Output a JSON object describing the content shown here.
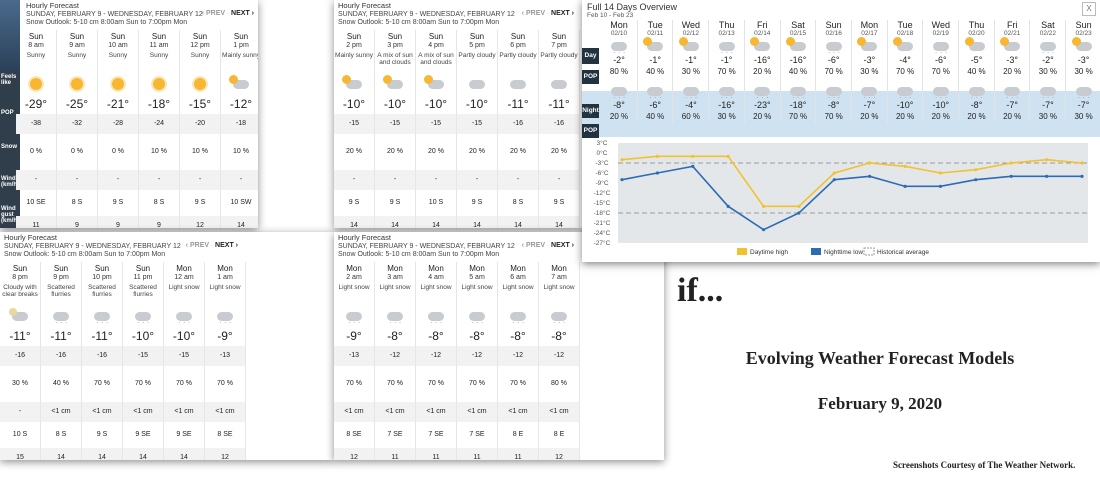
{
  "panel_common": {
    "title": "Hourly Forecast",
    "range": "SUNDAY, FEBRUARY 9 - WEDNESDAY, FEBRUARY 12",
    "outlook": "Snow Outlook: 5-10 cm 8:00am Sun to 7:00pm Mon",
    "prev": "‹ PREV",
    "next": "NEXT ›"
  },
  "row_labels": {
    "feels": "Feels like",
    "pop": "POP",
    "snow": "Snow",
    "wind": "Wind (km/h)",
    "gust": "Wind gust (km/h)"
  },
  "panel1": [
    {
      "day": "Sun",
      "time": "8 am",
      "cond": "Sunny",
      "icon": "sun-icon",
      "temp": "-29°",
      "feels": "-38",
      "pop": "0 %",
      "snow": "-",
      "wind": "10 SE",
      "gust": "11"
    },
    {
      "day": "Sun",
      "time": "9 am",
      "cond": "Sunny",
      "icon": "sun-icon",
      "temp": "-25°",
      "feels": "-32",
      "pop": "0 %",
      "snow": "-",
      "wind": "8 S",
      "gust": "9"
    },
    {
      "day": "Sun",
      "time": "10 am",
      "cond": "Sunny",
      "icon": "sun-icon",
      "temp": "-21°",
      "feels": "-28",
      "pop": "0 %",
      "snow": "-",
      "wind": "9 S",
      "gust": "9"
    },
    {
      "day": "Sun",
      "time": "11 am",
      "cond": "Sunny",
      "icon": "sun-icon",
      "temp": "-18°",
      "feels": "-24",
      "pop": "10 %",
      "snow": "-",
      "wind": "8 S",
      "gust": "9"
    },
    {
      "day": "Sun",
      "time": "12 pm",
      "cond": "Sunny",
      "icon": "sun-icon",
      "temp": "-15°",
      "feels": "-20",
      "pop": "10 %",
      "snow": "-",
      "wind": "9 S",
      "gust": "12"
    },
    {
      "day": "Sun",
      "time": "1 pm",
      "cond": "Mainly sunny",
      "icon": "sun-cloud-icon",
      "temp": "-12°",
      "feels": "-18",
      "pop": "10 %",
      "snow": "-",
      "wind": "10 SW",
      "gust": "14"
    }
  ],
  "panel2": [
    {
      "day": "Sun",
      "time": "2 pm",
      "cond": "Mainly sunny",
      "icon": "sun-cloud-icon",
      "temp": "-10°",
      "feels": "-15",
      "pop": "20 %",
      "snow": "-",
      "wind": "9 S",
      "gust": "14"
    },
    {
      "day": "Sun",
      "time": "3 pm",
      "cond": "A mix of sun and clouds",
      "icon": "sun-cloud-icon",
      "temp": "-10°",
      "feels": "-15",
      "pop": "20 %",
      "snow": "-",
      "wind": "9 S",
      "gust": "14"
    },
    {
      "day": "Sun",
      "time": "4 pm",
      "cond": "A mix of sun and clouds",
      "icon": "sun-cloud-icon",
      "temp": "-10°",
      "feels": "-15",
      "pop": "20 %",
      "snow": "-",
      "wind": "10 S",
      "gust": "14"
    },
    {
      "day": "Sun",
      "time": "5 pm",
      "cond": "Partly cloudy",
      "icon": "cloud-icon",
      "temp": "-10°",
      "feels": "-15",
      "pop": "20 %",
      "snow": "-",
      "wind": "9 S",
      "gust": "14"
    },
    {
      "day": "Sun",
      "time": "6 pm",
      "cond": "Partly cloudy",
      "icon": "cloud-icon",
      "temp": "-11°",
      "feels": "-16",
      "pop": "20 %",
      "snow": "-",
      "wind": "8 S",
      "gust": "14"
    },
    {
      "day": "Sun",
      "time": "7 pm",
      "cond": "Partly cloudy",
      "icon": "cloud-icon",
      "temp": "-11°",
      "feels": "-16",
      "pop": "20 %",
      "snow": "-",
      "wind": "9 S",
      "gust": "14"
    }
  ],
  "panel3": [
    {
      "day": "Sun",
      "time": "8 pm",
      "cond": "Cloudy with clear breaks",
      "icon": "cloud-moon-icon",
      "temp": "-11°",
      "feels": "-16",
      "pop": "30 %",
      "snow": "-",
      "wind": "10 S",
      "gust": "15"
    },
    {
      "day": "Sun",
      "time": "9 pm",
      "cond": "Scattered flurries",
      "icon": "snow-cloud-icon",
      "temp": "-11°",
      "feels": "-16",
      "pop": "40 %",
      "snow": "<1 cm",
      "wind": "8 S",
      "gust": "14"
    },
    {
      "day": "Sun",
      "time": "10 pm",
      "cond": "Scattered flurries",
      "icon": "snow-cloud-icon",
      "temp": "-11°",
      "feels": "-16",
      "pop": "70 %",
      "snow": "<1 cm",
      "wind": "9 S",
      "gust": "14"
    },
    {
      "day": "Sun",
      "time": "11 pm",
      "cond": "Scattered flurries",
      "icon": "snow-cloud-icon",
      "temp": "-10°",
      "feels": "-15",
      "pop": "70 %",
      "snow": "<1 cm",
      "wind": "9 SE",
      "gust": "14"
    },
    {
      "day": "Mon",
      "time": "12 am",
      "cond": "Light snow",
      "icon": "snow-cloud-icon",
      "temp": "-10°",
      "feels": "-15",
      "pop": "70 %",
      "snow": "<1 cm",
      "wind": "9 SE",
      "gust": "14"
    },
    {
      "day": "Mon",
      "time": "1 am",
      "cond": "Light snow",
      "icon": "snow-cloud-icon",
      "temp": "-9°",
      "feels": "-13",
      "pop": "70 %",
      "snow": "<1 cm",
      "wind": "8 SE",
      "gust": "12"
    }
  ],
  "panel4": [
    {
      "day": "Mon",
      "time": "2 am",
      "cond": "Light snow",
      "icon": "snow-cloud-icon",
      "temp": "-9°",
      "feels": "-13",
      "pop": "70 %",
      "snow": "<1 cm",
      "wind": "8 SE",
      "gust": "12"
    },
    {
      "day": "Mon",
      "time": "3 am",
      "cond": "Light snow",
      "icon": "snow-cloud-icon",
      "temp": "-8°",
      "feels": "-12",
      "pop": "70 %",
      "snow": "<1 cm",
      "wind": "7 SE",
      "gust": "11"
    },
    {
      "day": "Mon",
      "time": "4 am",
      "cond": "Light snow",
      "icon": "snow-cloud-icon",
      "temp": "-8°",
      "feels": "-12",
      "pop": "70 %",
      "snow": "<1 cm",
      "wind": "7 SE",
      "gust": "11"
    },
    {
      "day": "Mon",
      "time": "5 am",
      "cond": "Light snow",
      "icon": "snow-cloud-icon",
      "temp": "-8°",
      "feels": "-12",
      "pop": "70 %",
      "snow": "<1 cm",
      "wind": "7 SE",
      "gust": "11"
    },
    {
      "day": "Mon",
      "time": "6 am",
      "cond": "Light snow",
      "icon": "snow-cloud-icon",
      "temp": "-8°",
      "feels": "-12",
      "pop": "70 %",
      "snow": "<1 cm",
      "wind": "8 E",
      "gust": "11"
    },
    {
      "day": "Mon",
      "time": "7 am",
      "cond": "Light snow",
      "icon": "snow-cloud-icon",
      "temp": "-8°",
      "feels": "-12",
      "pop": "80 %",
      "snow": "<1 cm",
      "wind": "8 E",
      "gust": "12"
    }
  ],
  "overview": {
    "title": "Full 14 Days Overview",
    "subtitle": "Feb 10 - Feb 23",
    "close": "X",
    "day_label": "Day",
    "pop_label": "POP",
    "night_label": "Night",
    "days": [
      {
        "name": "Mon",
        "date": "02/10",
        "high": "-2°",
        "dpop": "80 %",
        "low": "-8°",
        "npop": "20 %"
      },
      {
        "name": "Tue",
        "date": "02/11",
        "high": "-1°",
        "dpop": "40 %",
        "low": "-6°",
        "npop": "40 %"
      },
      {
        "name": "Wed",
        "date": "02/12",
        "high": "-1°",
        "dpop": "30 %",
        "low": "-4°",
        "npop": "60 %"
      },
      {
        "name": "Thu",
        "date": "02/13",
        "high": "-1°",
        "dpop": "70 %",
        "low": "-16°",
        "npop": "30 %"
      },
      {
        "name": "Fri",
        "date": "02/14",
        "high": "-16°",
        "dpop": "20 %",
        "low": "-23°",
        "npop": "20 %"
      },
      {
        "name": "Sat",
        "date": "02/15",
        "high": "-16°",
        "dpop": "40 %",
        "low": "-18°",
        "npop": "70 %"
      },
      {
        "name": "Sun",
        "date": "02/16",
        "high": "-6°",
        "dpop": "70 %",
        "low": "-8°",
        "npop": "70 %"
      },
      {
        "name": "Mon",
        "date": "02/17",
        "high": "-3°",
        "dpop": "30 %",
        "low": "-7°",
        "npop": "20 %"
      },
      {
        "name": "Tue",
        "date": "02/18",
        "high": "-4°",
        "dpop": "70 %",
        "low": "-10°",
        "npop": "20 %"
      },
      {
        "name": "Wed",
        "date": "02/19",
        "high": "-6°",
        "dpop": "70 %",
        "low": "-10°",
        "npop": "20 %"
      },
      {
        "name": "Thu",
        "date": "02/20",
        "high": "-5°",
        "dpop": "40 %",
        "low": "-8°",
        "npop": "20 %"
      },
      {
        "name": "Fri",
        "date": "02/21",
        "high": "-3°",
        "dpop": "20 %",
        "low": "-7°",
        "npop": "20 %"
      },
      {
        "name": "Sat",
        "date": "02/22",
        "high": "-2°",
        "dpop": "30 %",
        "low": "-7°",
        "npop": "30 %"
      },
      {
        "name": "Sun",
        "date": "02/23",
        "high": "-3°",
        "dpop": "30 %",
        "low": "-7°",
        "npop": "30 %"
      }
    ]
  },
  "chart_data": {
    "type": "line",
    "x": [
      "02/10",
      "02/11",
      "02/12",
      "02/13",
      "02/14",
      "02/15",
      "02/16",
      "02/17",
      "02/18",
      "02/19",
      "02/20",
      "02/21",
      "02/22",
      "02/23"
    ],
    "series": [
      {
        "name": "Daytime high",
        "color": "#f2c12e",
        "values": [
          -2,
          -1,
          -1,
          -1,
          -16,
          -16,
          -6,
          -3,
          -4,
          -6,
          -5,
          -3,
          -2,
          -3
        ]
      },
      {
        "name": "Nighttime low",
        "color": "#2d6bb5",
        "values": [
          -8,
          -6,
          -4,
          -16,
          -23,
          -18,
          -8,
          -7,
          -10,
          -10,
          -8,
          -7,
          -7,
          -7
        ]
      },
      {
        "name": "Historical average",
        "color": "#999999",
        "values": [
          -3,
          -3,
          -3,
          -3,
          -3,
          -3,
          -3,
          -3,
          -3,
          -3,
          -3,
          -3,
          -3,
          -3
        ]
      },
      {
        "name": "Historical average low",
        "color": "#999999",
        "values": [
          -18,
          -18,
          -18,
          -18,
          -18,
          -18,
          -18,
          -18,
          -18,
          -18,
          -18,
          -18,
          -18,
          -18
        ]
      }
    ],
    "yticks": [
      "3°C",
      "0°C",
      "-3°C",
      "-6°C",
      "-9°C",
      "-12°C",
      "-15°C",
      "-18°C",
      "-21°C",
      "-24°C",
      "-27°C"
    ],
    "ylim": [
      -27,
      3
    ],
    "legend": [
      "Daytime high",
      "Nighttime low",
      "Historical average"
    ]
  },
  "text": {
    "if": "if...",
    "main": "Evolving Weather Forecast Models",
    "date": "February 9, 2020",
    "credit": "Screenshots Courtesy of The Weather Network."
  }
}
